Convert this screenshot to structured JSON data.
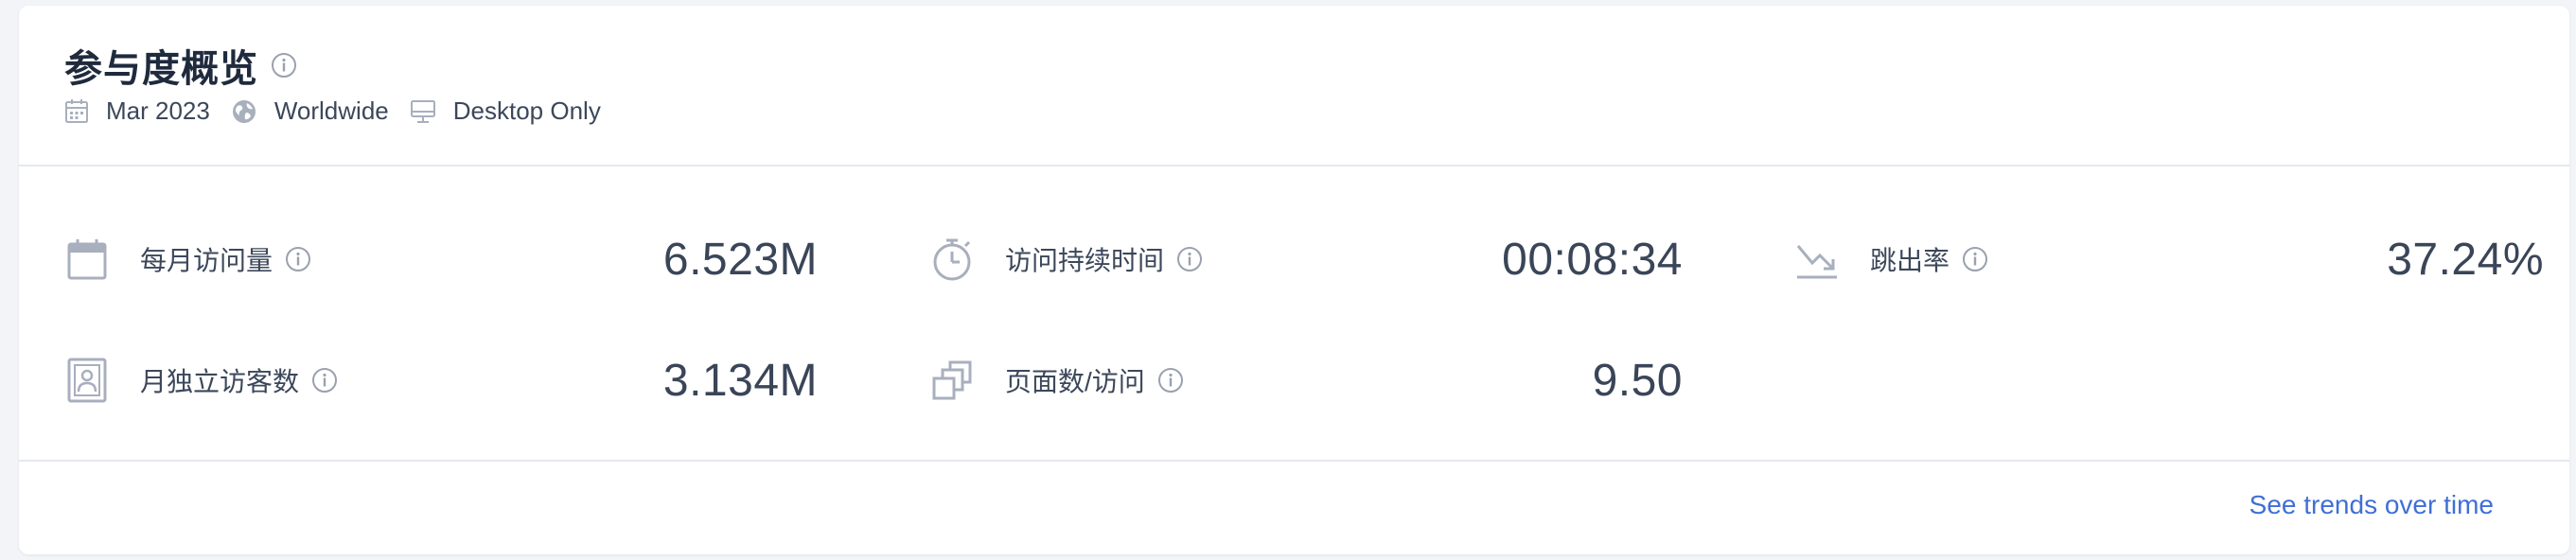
{
  "header": {
    "title": "参与度概览",
    "meta": {
      "date": "Mar 2023",
      "region": "Worldwide",
      "device": "Desktop Only"
    }
  },
  "metrics": [
    {
      "label": "每月访问量",
      "value": "6.523M",
      "icon": "calendar-icon"
    },
    {
      "label": "访问持续时间",
      "value": "00:08:34",
      "icon": "stopwatch-icon"
    },
    {
      "label": "跳出率",
      "value": "37.24%",
      "icon": "bounce-arrow-icon"
    },
    {
      "label": "月独立访客数",
      "value": "3.134M",
      "icon": "contact-card-icon"
    },
    {
      "label": "页面数/访问",
      "value": "9.50",
      "icon": "pages-stack-icon"
    }
  ],
  "footer": {
    "link_label": "See trends over time"
  },
  "colors": {
    "accent_link": "#3f6fd6",
    "icon_gray": "#a8afbd",
    "text_dark": "#1f2a3d"
  }
}
